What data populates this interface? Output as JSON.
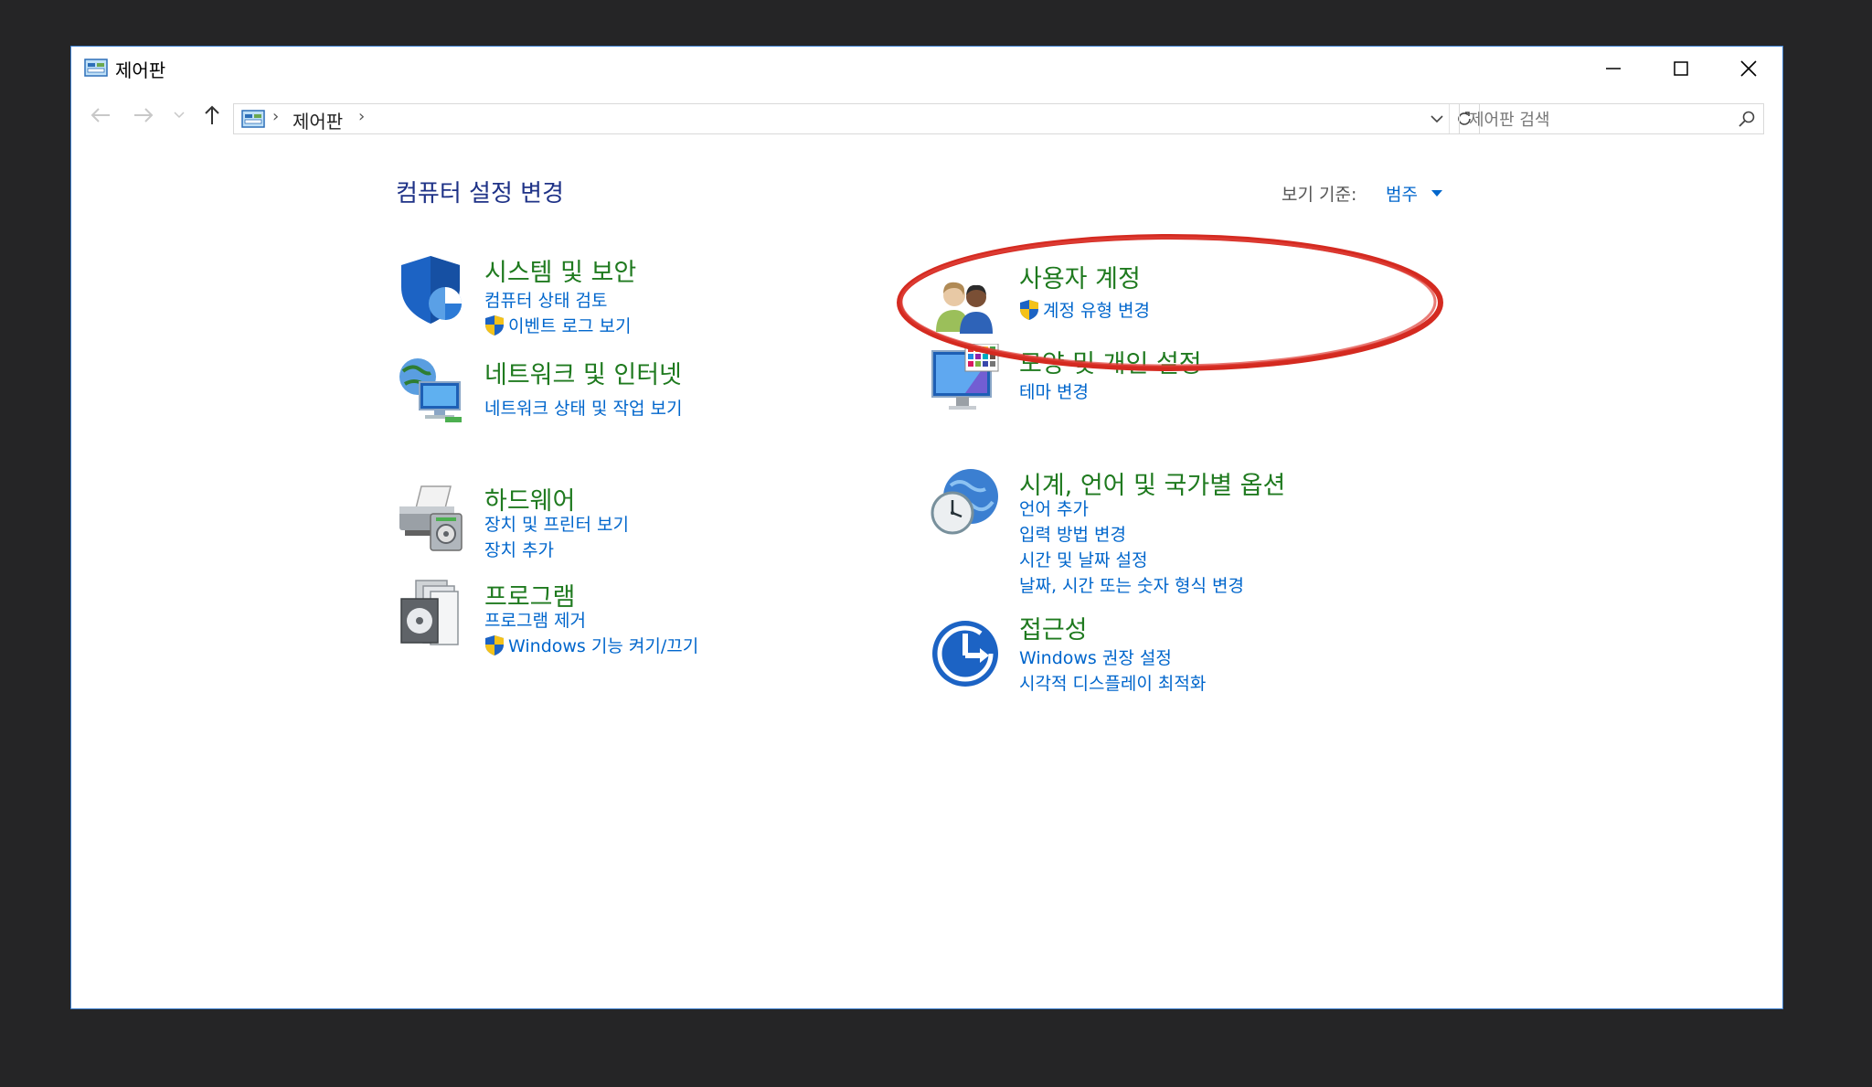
{
  "window": {
    "title": "제어판",
    "controls": {
      "minimize": "minimize-icon",
      "maximize": "maximize-icon",
      "close": "close-icon"
    }
  },
  "navigation": {
    "breadcrumb": [
      "제어판"
    ],
    "search_placeholder": "제어판 검색"
  },
  "main": {
    "heading": "컴퓨터 설정 변경",
    "view_by_label": "보기 기준:",
    "view_by_value": "범주",
    "left_categories": [
      {
        "title": "시스템 및 보안",
        "icon": "shield-icon",
        "links": [
          "컴퓨터 상태 검토",
          "이벤트 로그 보기"
        ]
      },
      {
        "title": "네트워크 및 인터넷",
        "icon": "network-icon",
        "links": [
          "네트워크 상태 및 작업 보기"
        ]
      },
      {
        "title": "하드웨어",
        "icon": "printer-icon",
        "links": [
          "장치 및 프린터 보기",
          "장치 추가"
        ]
      },
      {
        "title": "프로그램",
        "icon": "programs-icon",
        "links": [
          "프로그램 제거",
          "Windows 기능 켜기/끄기"
        ]
      }
    ],
    "right_categories": [
      {
        "title": "사용자 계정",
        "icon": "users-icon",
        "links": [
          "계정 유형 변경"
        ]
      },
      {
        "title": "모양 및 개인 설정",
        "icon": "monitor-palette-icon",
        "links": [
          "테마 변경"
        ]
      },
      {
        "title": "시계, 언어 및 국가별 옵션",
        "icon": "clock-globe-icon",
        "links": [
          "언어 추가",
          "입력 방법 변경",
          "시간 및 날짜 설정",
          "날짜, 시간 또는 숫자 형식 변경"
        ]
      },
      {
        "title": "접근성",
        "icon": "accessibility-icon",
        "links": [
          "Windows 권장 설정",
          "시각적 디스플레이 최적화"
        ]
      }
    ]
  },
  "colors": {
    "category_title": "#1f7a1f",
    "link": "#0066cc",
    "heading": "#1e3287",
    "annotation": "#d42a20",
    "window_border": "#3e7fcc"
  }
}
